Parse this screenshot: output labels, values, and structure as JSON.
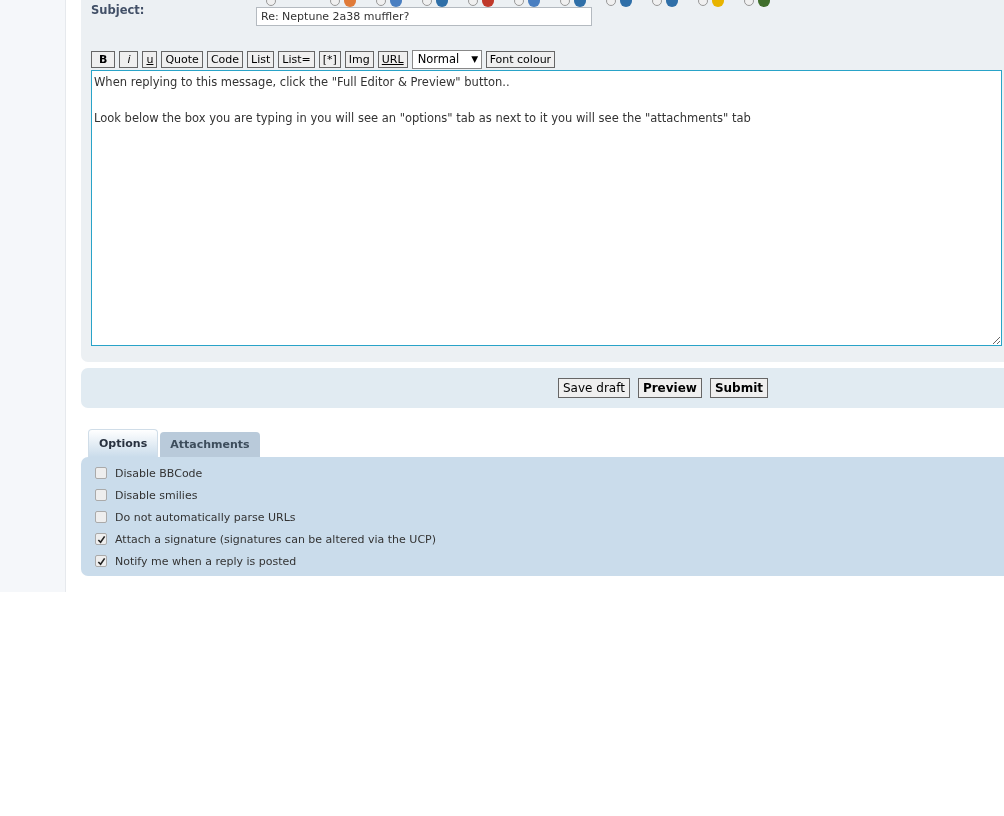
{
  "post_icons": [
    {
      "selected": false
    },
    {
      "selected": false,
      "color": "#e07b39"
    },
    {
      "selected": false,
      "color": "#4a7fc1"
    },
    {
      "selected": false,
      "color": "#2f6fa8"
    },
    {
      "selected": false,
      "color": "#c0392b"
    },
    {
      "selected": false,
      "color": "#4a7fc1"
    },
    {
      "selected": false,
      "color": "#2f6fa8"
    },
    {
      "selected": false,
      "color": "#2f6fa8"
    },
    {
      "selected": false,
      "color": "#2f6fa8"
    },
    {
      "selected": false,
      "color": "#e8b400"
    },
    {
      "selected": false,
      "color": "#3f6e2b"
    }
  ],
  "subject": {
    "label": "Subject:",
    "value": "Re: Neptune 2a38 muffler?"
  },
  "toolbar": [
    {
      "kind": "bold",
      "label": "B"
    },
    {
      "kind": "italic",
      "label": "i"
    },
    {
      "kind": "underline",
      "label": "u"
    },
    {
      "kind": "button",
      "label": "Quote"
    },
    {
      "kind": "button",
      "label": "Code"
    },
    {
      "kind": "button",
      "label": "List"
    },
    {
      "kind": "button",
      "label": "List="
    },
    {
      "kind": "button",
      "label": "[*]"
    },
    {
      "kind": "button",
      "label": "Img"
    },
    {
      "kind": "underline",
      "label": "URL"
    },
    {
      "kind": "select",
      "label": "Normal",
      "caret": "▼"
    },
    {
      "kind": "button",
      "label": "Font colour"
    }
  ],
  "message": "When replying to this message, click the \"Full Editor & Preview\" button..\n\nLook below the box you are typing in you will see an \"options\" tab as next to it you will see the \"attachments\" tab",
  "actions": [
    {
      "label": "Save draft",
      "kind": "secondary"
    },
    {
      "label": "Preview",
      "kind": "primary"
    },
    {
      "label": "Submit",
      "kind": "primary"
    }
  ],
  "tabs": [
    {
      "label": "Options",
      "selected": true
    },
    {
      "label": "Attachments",
      "selected": false
    }
  ],
  "options": [
    {
      "label": "Disable BBCode",
      "checked": false
    },
    {
      "label": "Disable smilies",
      "checked": false
    },
    {
      "label": "Do not automatically parse URLs",
      "checked": false
    },
    {
      "label": "Attach a signature (signatures can be altered via the UCP)",
      "checked": true
    },
    {
      "label": "Notify me when a reply is posted",
      "checked": true
    }
  ]
}
